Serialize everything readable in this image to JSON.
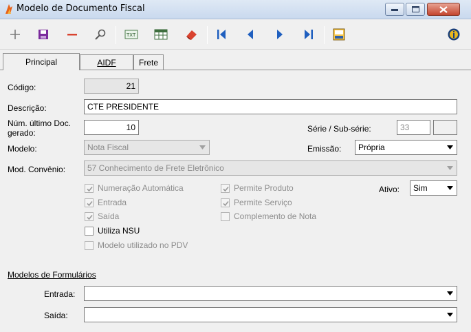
{
  "window": {
    "title": "Modelo de Documento Fiscal"
  },
  "toolbar": {
    "buttons": [
      "add-icon",
      "save-icon",
      "delete-icon",
      "search-icon",
      "text-icon",
      "grid-icon",
      "eraser-icon",
      "first-record-icon",
      "prev-record-icon",
      "next-record-icon",
      "last-record-icon",
      "log-icon",
      "info-icon"
    ]
  },
  "tabs": [
    {
      "label": "Principal",
      "active": true
    },
    {
      "label": "AIDF",
      "active": false
    },
    {
      "label": "Frete",
      "active": false
    }
  ],
  "form": {
    "codigo_label": "Código:",
    "codigo_value": "21",
    "descricao_label": "Descrição:",
    "descricao_value": "CTE PRESIDENTE",
    "num_ultimo_label_1": "Núm. último Doc.",
    "num_ultimo_label_2": "gerado:",
    "num_ultimo_value": "10",
    "serie_label": "Série / Sub-série:",
    "serie_value": "33",
    "subserie_value": "",
    "modelo_label": "Modelo:",
    "modelo_value": "Nota Fiscal",
    "emissao_label": "Emissão:",
    "emissao_value": "Própria",
    "mod_convenio_label": "Mod. Convênio:",
    "mod_convenio_value": "57 Conhecimento de Frete Eletrônico",
    "ativo_label": "Ativo:",
    "ativo_value": "Sim"
  },
  "checkboxes": {
    "numeracao_automatica": {
      "label": "Numeração Automática",
      "checked": true,
      "enabled": false
    },
    "entrada": {
      "label": "Entrada",
      "checked": true,
      "enabled": false
    },
    "saida": {
      "label": "Saída",
      "checked": true,
      "enabled": false
    },
    "utiliza_nsu": {
      "label": "Utiliza NSU",
      "checked": false,
      "enabled": true
    },
    "modelo_pdv": {
      "label": "Modelo utilizado no PDV",
      "checked": false,
      "enabled": false
    },
    "permite_produto": {
      "label": "Permite Produto",
      "checked": true,
      "enabled": false
    },
    "permite_servico": {
      "label": "Permite Serviço",
      "checked": true,
      "enabled": false
    },
    "complemento_nota": {
      "label": "Complemento de Nota",
      "checked": false,
      "enabled": false
    }
  },
  "formularios": {
    "title": "Modelos de Formulários",
    "entrada_label": "Entrada:",
    "entrada_value": "",
    "saida_label": "Saída:",
    "saida_value": ""
  },
  "colors": {
    "accent_blue": "#1f5fbf",
    "save_purple": "#7a2a9c",
    "delete_red": "#d9432f"
  }
}
